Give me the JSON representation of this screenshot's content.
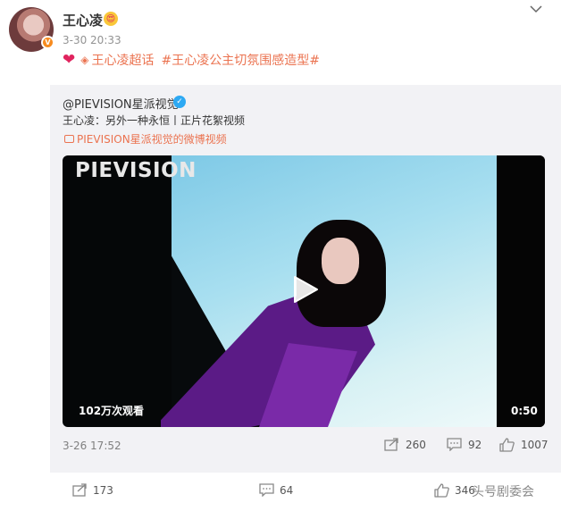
{
  "post": {
    "username": "王心凌",
    "emoji": "😍",
    "time": "3-30 20:33",
    "topic_icon": "gem-icon",
    "topics": [
      "王心凌超话",
      "#王心凌公主切氛围感造型#"
    ]
  },
  "repost": {
    "author": "@PIEVISION星派视觉",
    "text": "王心凌：另外一种永恒丨正片花絮视频",
    "video_link": "PIEVISION星派视觉的微博视频",
    "video": {
      "watermark": "PIEVISION",
      "views": "102万次观看",
      "duration": "0:50"
    },
    "time": "3-26 17:52",
    "stats": {
      "reposts": "260",
      "comments": "92",
      "likes": "1007"
    }
  },
  "actions": {
    "reposts": "173",
    "comments": "64",
    "likes": "346"
  },
  "source_watermark": "头号剧委会",
  "colors": {
    "accent": "#eb7350",
    "heart": "#e0245e",
    "verified": "#2da9f3",
    "badge": "#f78b1f"
  }
}
